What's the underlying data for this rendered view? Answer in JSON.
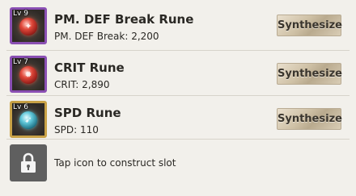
{
  "runes": [
    {
      "level": "Lv 9",
      "name": "PM. DEF Break Rune",
      "stat": "PM. DEF Break: 2,200",
      "frame": "purple",
      "icon": "red-rune-orb-icon",
      "button": "Synthesize"
    },
    {
      "level": "Lv 7",
      "name": "CRIT Rune",
      "stat": "CRIT: 2,890",
      "frame": "purple",
      "icon": "red-rune-orb-icon",
      "button": "Synthesize"
    },
    {
      "level": "Lv 6",
      "name": "SPD Rune",
      "stat": "SPD: 110",
      "frame": "gold",
      "icon": "blue-rune-orb-icon",
      "button": "Synthesize"
    }
  ],
  "locked_slot": {
    "icon": "lock-icon",
    "text": "Tap icon to construct slot"
  },
  "colors": {
    "background": "#f2f0eb",
    "frame_purple": "#8a4fb3",
    "frame_gold": "#c9a247",
    "lock_slot": "#5f5f5f"
  }
}
